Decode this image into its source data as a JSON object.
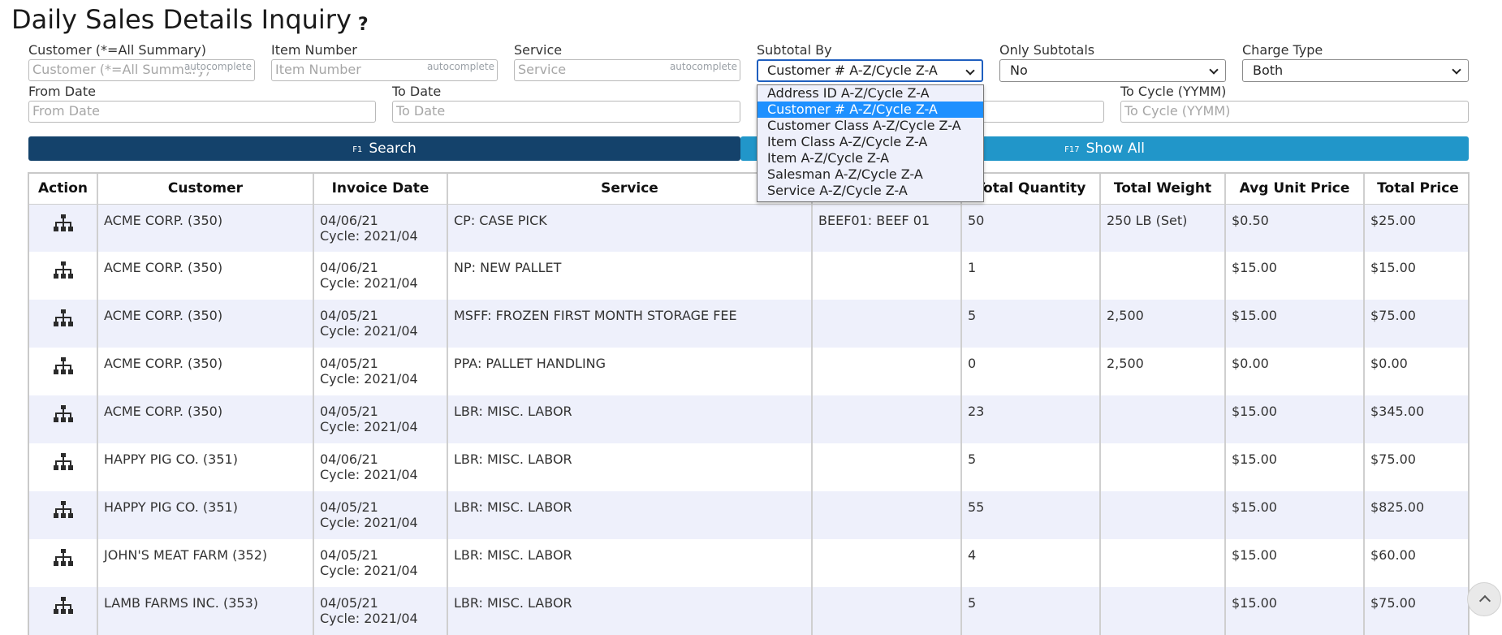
{
  "page": {
    "title": "Daily Sales Details Inquiry",
    "help": "?"
  },
  "filters": {
    "customer": {
      "label": "Customer (*=All Summary)",
      "placeholder": "Customer (*=All Summary)",
      "hint": "autocomplete"
    },
    "item_number": {
      "label": "Item Number",
      "placeholder": "Item Number",
      "hint": "autocomplete"
    },
    "service": {
      "label": "Service",
      "placeholder": "Service",
      "hint": "autocomplete"
    },
    "subtotal_by": {
      "label": "Subtotal By",
      "value": "Customer # A-Z/Cycle Z-A"
    },
    "only_subtotals": {
      "label": "Only Subtotals",
      "value": "No"
    },
    "charge_type": {
      "label": "Charge Type",
      "value": "Both"
    },
    "from_date": {
      "label": "From Date",
      "placeholder": "From Date"
    },
    "to_date": {
      "label": "To Date",
      "placeholder": "To Date"
    },
    "to_cycle": {
      "label": "To Cycle (YYMM)",
      "placeholder": "To Cycle (YYMM)"
    }
  },
  "buttons": {
    "search": {
      "fkey": "F1",
      "label": "Search"
    },
    "show_all": {
      "fkey": "F17",
      "label": "Show All"
    }
  },
  "subtotal_dropdown": {
    "options": [
      "Address ID A-Z/Cycle Z-A",
      "Customer # A-Z/Cycle Z-A",
      "Customer Class A-Z/Cycle Z-A",
      "Item Class A-Z/Cycle Z-A",
      "Item A-Z/Cycle Z-A",
      "Salesman A-Z/Cycle Z-A",
      "Service A-Z/Cycle Z-A"
    ],
    "selected_index": 1
  },
  "table": {
    "columns": [
      "Action",
      "Customer",
      "Invoice Date",
      "Service",
      "",
      "Total Quantity",
      "Total Weight",
      "Avg Unit Price",
      "Total Price"
    ],
    "rows": [
      {
        "customer": "ACME CORP. (350)",
        "date": "04/06/21",
        "cycle": "Cycle: 2021/04",
        "service": "CP: CASE PICK",
        "item": "BEEF01: BEEF 01",
        "qty": "50",
        "weight": "250 LB (Set)",
        "avg": "$0.50",
        "total": "$25.00"
      },
      {
        "customer": "ACME CORP. (350)",
        "date": "04/06/21",
        "cycle": "Cycle: 2021/04",
        "service": "NP: NEW PALLET",
        "item": "",
        "qty": "1",
        "weight": "",
        "avg": "$15.00",
        "total": "$15.00"
      },
      {
        "customer": "ACME CORP. (350)",
        "date": "04/05/21",
        "cycle": "Cycle: 2021/04",
        "service": "MSFF: FROZEN FIRST MONTH STORAGE FEE",
        "item": "",
        "qty": "5",
        "weight": "2,500",
        "avg": "$15.00",
        "total": "$75.00"
      },
      {
        "customer": "ACME CORP. (350)",
        "date": "04/05/21",
        "cycle": "Cycle: 2021/04",
        "service": "PPA: PALLET HANDLING",
        "item": "",
        "qty": "0",
        "weight": "2,500",
        "avg": "$0.00",
        "total": "$0.00"
      },
      {
        "customer": "ACME CORP. (350)",
        "date": "04/05/21",
        "cycle": "Cycle: 2021/04",
        "service": "LBR: MISC. LABOR",
        "item": "",
        "qty": "23",
        "weight": "",
        "avg": "$15.00",
        "total": "$345.00"
      },
      {
        "customer": "HAPPY PIG CO. (351)",
        "date": "04/06/21",
        "cycle": "Cycle: 2021/04",
        "service": "LBR: MISC. LABOR",
        "item": "",
        "qty": "5",
        "weight": "",
        "avg": "$15.00",
        "total": "$75.00"
      },
      {
        "customer": "HAPPY PIG CO. (351)",
        "date": "04/05/21",
        "cycle": "Cycle: 2021/04",
        "service": "LBR: MISC. LABOR",
        "item": "",
        "qty": "55",
        "weight": "",
        "avg": "$15.00",
        "total": "$825.00"
      },
      {
        "customer": "JOHN'S MEAT FARM (352)",
        "date": "04/05/21",
        "cycle": "Cycle: 2021/04",
        "service": "LBR: MISC. LABOR",
        "item": "",
        "qty": "4",
        "weight": "",
        "avg": "$15.00",
        "total": "$60.00"
      },
      {
        "customer": "LAMB FARMS INC. (353)",
        "date": "04/05/21",
        "cycle": "Cycle: 2021/04",
        "service": "LBR: MISC. LABOR",
        "item": "",
        "qty": "5",
        "weight": "",
        "avg": "$15.00",
        "total": "$75.00"
      }
    ]
  },
  "icons": {
    "row_action": "hierarchy-icon",
    "scroll_top": "chevron-up-icon"
  },
  "colors": {
    "search_button": "#14426b",
    "show_all_button": "#2196c9",
    "row_stripe": "#eef0fb",
    "dropdown_selected": "#1e90ff"
  }
}
